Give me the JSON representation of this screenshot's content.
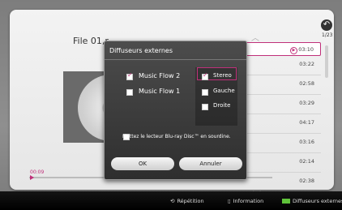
{
  "player": {
    "file_title": "File 01,r",
    "page_count": "1/23",
    "back_icon": "back-arrow-icon",
    "progress_time": "00:09",
    "tracks": [
      {
        "time": "03:10",
        "selected": true
      },
      {
        "time": "03:22",
        "selected": false
      },
      {
        "time": "02:58",
        "selected": false
      },
      {
        "time": "03:29",
        "selected": false
      },
      {
        "time": "04:17",
        "selected": false
      },
      {
        "time": "03:16",
        "selected": false
      },
      {
        "time": "02:14",
        "selected": false
      },
      {
        "time": "02:38",
        "selected": false
      }
    ]
  },
  "dialog": {
    "title": "Diffuseurs externes",
    "speakers": [
      {
        "label": "Music Flow 2",
        "checked": true
      },
      {
        "label": "Music Flow 1",
        "checked": false
      }
    ],
    "channels": [
      {
        "label": "Stereo",
        "checked": true
      },
      {
        "label": "Gauche",
        "checked": false
      },
      {
        "label": "Droite",
        "checked": false
      }
    ],
    "note": "Mettez le lecteur Blu-ray Disc™ en sourdine.",
    "note_checked": false,
    "ok_label": "OK",
    "cancel_label": "Annuler"
  },
  "bottom_bar": {
    "repeat_label": "Répétition",
    "info_label": "Information",
    "external_label": "Diffuseurs externes",
    "green_key_color": "#5fc23a"
  },
  "accent_color": "#c0307a"
}
